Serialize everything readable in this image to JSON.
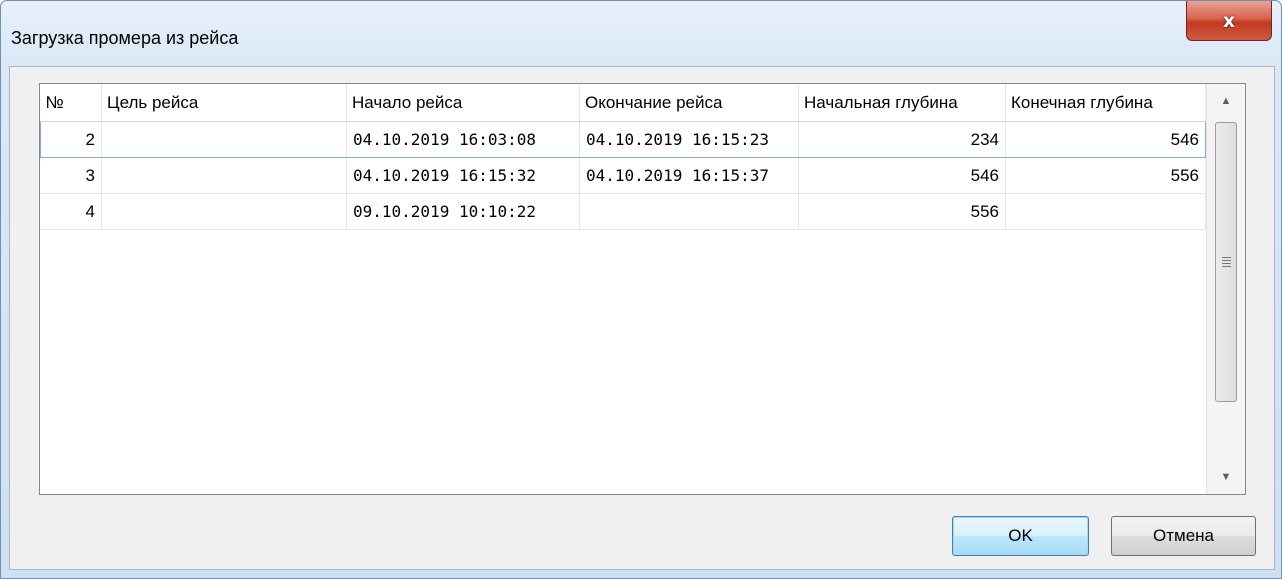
{
  "window": {
    "title": "Загрузка промера из рейса",
    "close_glyph": "x"
  },
  "grid": {
    "columns": [
      "№",
      "Цель рейса",
      "Начало рейса",
      "Окончание рейса",
      "Начальная глубина",
      "Конечная глубина"
    ],
    "rows": [
      {
        "num": "2",
        "goal": "",
        "start": "04.10.2019 16:03:08",
        "end": "04.10.2019 16:15:23",
        "depth_start": "234",
        "depth_end": "546"
      },
      {
        "num": "3",
        "goal": "",
        "start": "04.10.2019 16:15:32",
        "end": "04.10.2019 16:15:37",
        "depth_start": "546",
        "depth_end": "556"
      },
      {
        "num": "4",
        "goal": "",
        "start": "09.10.2019 10:10:22",
        "end": "",
        "depth_start": "556",
        "depth_end": ""
      }
    ],
    "selected_row": 0
  },
  "scrollbar": {
    "up_glyph": "▲",
    "down_glyph": "▼"
  },
  "buttons": {
    "ok_label": "OK",
    "cancel_label": "Отмена"
  }
}
